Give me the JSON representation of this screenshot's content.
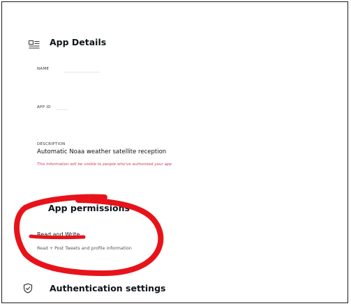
{
  "app_details": {
    "title": "App Details",
    "name_label": "NAME",
    "app_id_label": "APP ID",
    "description_label": "DESCRIPTION",
    "description_value": "Automatic Noaa weather satellite reception",
    "visibility_hint": "This information will be visible to people who've authorized your app"
  },
  "app_permissions": {
    "title": "App permissions",
    "level": "Read and Write",
    "description": "Read + Post Tweets and profile information"
  },
  "authentication": {
    "title": "Authentication settings"
  },
  "colors": {
    "annotation_red": "#e8131a",
    "hint_red": "#d33a5a",
    "text": "#0f1419"
  },
  "icons": {
    "app_details": "id-card-icon",
    "authentication": "shield-check-icon"
  }
}
